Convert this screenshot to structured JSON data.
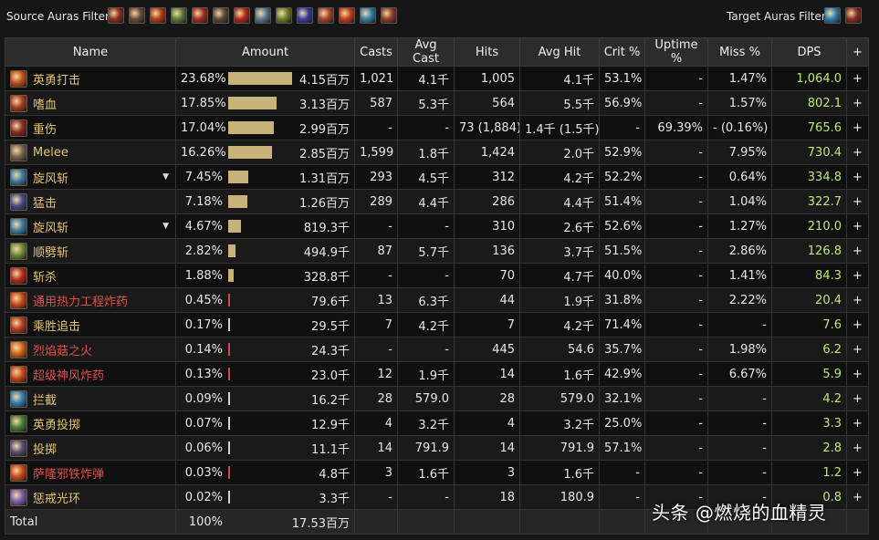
{
  "filters": {
    "source_label": "Source Auras Filter:",
    "target_label": "Target Auras Filter:",
    "source_icons": [
      {
        "name": "claw-icon",
        "color": "#8b2b1d"
      },
      {
        "name": "fist-icon",
        "color": "#6a4a3c"
      },
      {
        "name": "flame-strike-icon",
        "color": "#b23a12"
      },
      {
        "name": "shield-slam-icon",
        "color": "#5a7a3a"
      },
      {
        "name": "blood-rage-icon",
        "color": "#a82a22"
      },
      {
        "name": "heroic-fist-icon",
        "color": "#5e4636"
      },
      {
        "name": "rage-icon",
        "color": "#b4281a"
      },
      {
        "name": "shatter-icon",
        "color": "#557a8e"
      },
      {
        "name": "warlord-icon",
        "color": "#6f7d2c"
      },
      {
        "name": "arcane-icon",
        "color": "#3a3aa0"
      },
      {
        "name": "bloodlust-icon",
        "color": "#a8422a"
      },
      {
        "name": "fire-burst-icon",
        "color": "#c23c16"
      },
      {
        "name": "frost-icon",
        "color": "#2f7ea8"
      },
      {
        "name": "berserker-icon",
        "color": "#8c3c2a"
      }
    ],
    "target_icons": [
      {
        "name": "vortex-icon",
        "color": "#2f7eb0"
      },
      {
        "name": "sunder-icon",
        "color": "#8a2a20"
      }
    ]
  },
  "table": {
    "columns": [
      "Name",
      "Amount",
      "Casts",
      "Avg Cast",
      "Hits",
      "Avg Hit",
      "Crit %",
      "Uptime %",
      "Miss %",
      "DPS",
      "+"
    ],
    "rows": [
      {
        "icon": "heroic-strike-icon",
        "icon_color": "#c0501c",
        "name": "英勇打击",
        "name_color": "gold",
        "pct": "23.68%",
        "bar": 1.0,
        "bar_color": "gold",
        "amount": "4.15百万",
        "casts": "1,021",
        "avg_cast": "4.1千",
        "hits": "1,005",
        "avg_hit": "4.1千",
        "crit": "53.1%",
        "uptime": "-",
        "miss": "1.47%",
        "dps": "1,064.0",
        "caret": false
      },
      {
        "icon": "bloodthirst-icon",
        "icon_color": "#a83a22",
        "name": "嗜血",
        "name_color": "gold",
        "pct": "17.85%",
        "bar": 0.754,
        "bar_color": "gold",
        "amount": "3.13百万",
        "casts": "587",
        "avg_cast": "5.3千",
        "hits": "564",
        "avg_hit": "5.5千",
        "crit": "56.9%",
        "uptime": "-",
        "miss": "1.57%",
        "dps": "802.1",
        "caret": false
      },
      {
        "icon": "deep-wound-icon",
        "icon_color": "#8a2a22",
        "name": "重伤",
        "name_color": "gold",
        "pct": "17.04%",
        "bar": 0.72,
        "bar_color": "gold",
        "amount": "2.99百万",
        "casts": "-",
        "avg_cast": "-",
        "hits": "73 (1,884)",
        "avg_hit": "1.4千 (1.5千)",
        "crit": "-",
        "uptime": "69.39%",
        "miss": "- (0.16%)",
        "dps": "765.6",
        "caret": false
      },
      {
        "icon": "melee-icon",
        "icon_color": "#7a6650",
        "name": "Melee",
        "name_color": "gold",
        "pct": "16.26%",
        "bar": 0.687,
        "bar_color": "gold",
        "amount": "2.85百万",
        "casts": "1,599",
        "avg_cast": "1.8千",
        "hits": "1,424",
        "avg_hit": "2.0千",
        "crit": "52.9%",
        "uptime": "-",
        "miss": "7.95%",
        "dps": "730.4",
        "caret": false
      },
      {
        "icon": "whirlwind-icon",
        "icon_color": "#3f7aa0",
        "name": "旋风斩",
        "name_color": "gold",
        "pct": "7.45%",
        "bar": 0.315,
        "bar_color": "gold",
        "amount": "1.31百万",
        "casts": "293",
        "avg_cast": "4.5千",
        "hits": "312",
        "avg_hit": "4.2千",
        "crit": "52.2%",
        "uptime": "-",
        "miss": "0.64%",
        "dps": "334.8",
        "caret": true
      },
      {
        "icon": "slam-icon",
        "icon_color": "#4a4a8a",
        "name": "猛击",
        "name_color": "gold",
        "pct": "7.18%",
        "bar": 0.303,
        "bar_color": "gold",
        "amount": "1.26百万",
        "casts": "289",
        "avg_cast": "4.4千",
        "hits": "286",
        "avg_hit": "4.4千",
        "crit": "51.4%",
        "uptime": "-",
        "miss": "1.04%",
        "dps": "322.7",
        "caret": false
      },
      {
        "icon": "whirlwind-icon",
        "icon_color": "#3f7aa0",
        "name": "旋风斩",
        "name_color": "gold",
        "pct": "4.67%",
        "bar": 0.197,
        "bar_color": "gold",
        "amount": "819.3千",
        "casts": "-",
        "avg_cast": "-",
        "hits": "310",
        "avg_hit": "2.6千",
        "crit": "52.6%",
        "uptime": "-",
        "miss": "1.27%",
        "dps": "210.0",
        "caret": true
      },
      {
        "icon": "cleave-icon",
        "icon_color": "#6e8a3a",
        "name": "顺劈斩",
        "name_color": "gold",
        "pct": "2.82%",
        "bar": 0.119,
        "bar_color": "gold",
        "amount": "494.9千",
        "casts": "87",
        "avg_cast": "5.7千",
        "hits": "136",
        "avg_hit": "3.7千",
        "crit": "51.5%",
        "uptime": "-",
        "miss": "2.86%",
        "dps": "126.8",
        "caret": false
      },
      {
        "icon": "execute-icon",
        "icon_color": "#b42a1c",
        "name": "斩杀",
        "name_color": "gold",
        "pct": "1.88%",
        "bar": 0.079,
        "bar_color": "gold",
        "amount": "328.8千",
        "casts": "-",
        "avg_cast": "-",
        "hits": "70",
        "avg_hit": "4.7千",
        "crit": "40.0%",
        "uptime": "-",
        "miss": "1.41%",
        "dps": "84.3",
        "caret": false
      },
      {
        "icon": "thermal-explosive-icon",
        "icon_color": "#c8461a",
        "name": "通用热力工程炸药",
        "name_color": "red",
        "pct": "0.45%",
        "bar": 0.019,
        "bar_color": "red",
        "amount": "79.6千",
        "casts": "13",
        "avg_cast": "6.3千",
        "hits": "44",
        "avg_hit": "1.9千",
        "crit": "31.8%",
        "uptime": "-",
        "miss": "2.22%",
        "dps": "20.4",
        "caret": false
      },
      {
        "icon": "victory-rush-icon",
        "icon_color": "#b43a1e",
        "name": "乘胜追击",
        "name_color": "gold",
        "pct": "0.17%",
        "bar": 0.007,
        "bar_color": "white",
        "amount": "29.5千",
        "casts": "7",
        "avg_cast": "4.2千",
        "hits": "7",
        "avg_hit": "4.2千",
        "crit": "71.4%",
        "uptime": "-",
        "miss": "-",
        "dps": "7.6",
        "caret": false
      },
      {
        "icon": "flame-mushroom-icon",
        "icon_color": "#d2641a",
        "name": "烈焰菇之火",
        "name_color": "red",
        "pct": "0.14%",
        "bar": 0.006,
        "bar_color": "red",
        "amount": "24.3千",
        "casts": "-",
        "avg_cast": "-",
        "hits": "445",
        "avg_hit": "54.6",
        "crit": "35.7%",
        "uptime": "-",
        "miss": "1.98%",
        "dps": "6.2",
        "caret": false
      },
      {
        "icon": "super-bomb-icon",
        "icon_color": "#c8461a",
        "name": "超级神风炸药",
        "name_color": "red",
        "pct": "0.13%",
        "bar": 0.005,
        "bar_color": "red",
        "amount": "23.0千",
        "casts": "12",
        "avg_cast": "1.9千",
        "hits": "14",
        "avg_hit": "1.6千",
        "crit": "42.9%",
        "uptime": "-",
        "miss": "6.67%",
        "dps": "5.9",
        "caret": false
      },
      {
        "icon": "intercept-icon",
        "icon_color": "#2f7eb0",
        "name": "拦截",
        "name_color": "gold",
        "pct": "0.09%",
        "bar": 0.004,
        "bar_color": "white",
        "amount": "16.2千",
        "casts": "28",
        "avg_cast": "579.0",
        "hits": "28",
        "avg_hit": "579.0",
        "crit": "32.1%",
        "uptime": "-",
        "miss": "-",
        "dps": "4.2",
        "caret": false
      },
      {
        "icon": "heroic-throw-icon",
        "icon_color": "#4a7a3a",
        "name": "英勇投掷",
        "name_color": "gold",
        "pct": "0.07%",
        "bar": 0.003,
        "bar_color": "white",
        "amount": "12.9千",
        "casts": "4",
        "avg_cast": "3.2千",
        "hits": "4",
        "avg_hit": "3.2千",
        "crit": "25.0%",
        "uptime": "-",
        "miss": "-",
        "dps": "3.3",
        "caret": false
      },
      {
        "icon": "throw-icon",
        "icon_color": "#5a4a7a",
        "name": "投掷",
        "name_color": "gold",
        "pct": "0.06%",
        "bar": 0.003,
        "bar_color": "white",
        "amount": "11.1千",
        "casts": "14",
        "avg_cast": "791.9",
        "hits": "14",
        "avg_hit": "791.9",
        "crit": "57.1%",
        "uptime": "-",
        "miss": "-",
        "dps": "2.8",
        "caret": false
      },
      {
        "icon": "saronite-bomb-icon",
        "icon_color": "#c8461a",
        "name": "萨隆邪铁炸弹",
        "name_color": "red",
        "pct": "0.03%",
        "bar": 0.001,
        "bar_color": "red",
        "amount": "4.8千",
        "casts": "3",
        "avg_cast": "1.6千",
        "hits": "3",
        "avg_hit": "1.6千",
        "crit": "-",
        "uptime": "-",
        "miss": "-",
        "dps": "1.2",
        "caret": false
      },
      {
        "icon": "retribution-aura-icon",
        "icon_color": "#7a5aa8",
        "name": "惩戒光环",
        "name_color": "gold",
        "pct": "0.02%",
        "bar": 0.001,
        "bar_color": "white",
        "amount": "3.3千",
        "casts": "-",
        "avg_cast": "-",
        "hits": "18",
        "avg_hit": "180.9",
        "crit": "-",
        "uptime": "-",
        "miss": "-",
        "dps": "0.8",
        "caret": false
      }
    ],
    "total": {
      "label": "Total",
      "pct": "100%",
      "amount": "17.53百万"
    }
  },
  "watermark": "头条 @燃烧的血精灵"
}
